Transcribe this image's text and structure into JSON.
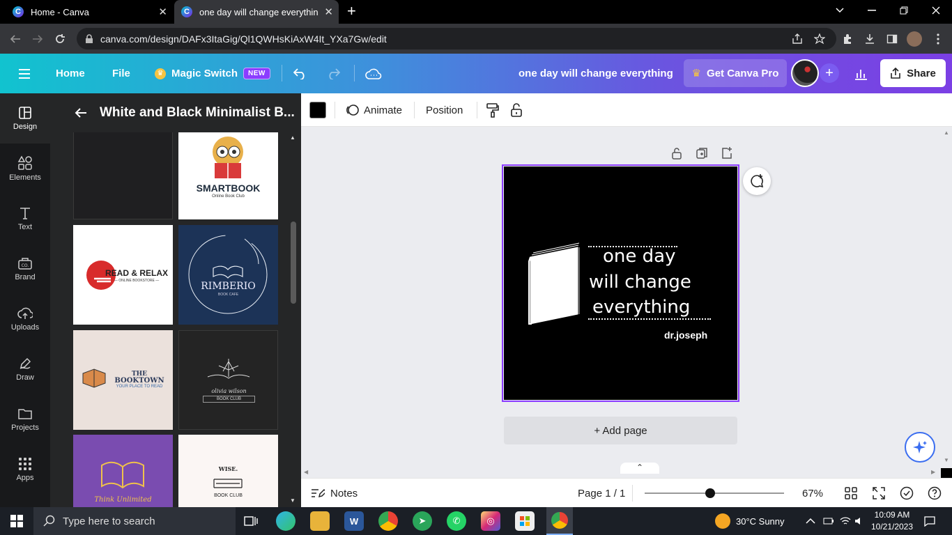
{
  "browser": {
    "tabs": [
      {
        "title": "Home - Canva"
      },
      {
        "title": "one day will change everything - Logo"
      }
    ],
    "url": "canva.com/design/DAFx3ItaGig/Ql1QWHsKiAxW4It_YXa7Gw/edit"
  },
  "header": {
    "home": "Home",
    "file": "File",
    "magic_switch": "Magic Switch",
    "new_badge": "NEW",
    "doc_title": "one day will change everything",
    "get_pro": "Get Canva Pro",
    "share": "Share"
  },
  "rail": [
    {
      "label": "Design",
      "icon": "design-icon"
    },
    {
      "label": "Elements",
      "icon": "elements-icon"
    },
    {
      "label": "Text",
      "icon": "text-icon"
    },
    {
      "label": "Brand",
      "icon": "brand-icon"
    },
    {
      "label": "Uploads",
      "icon": "uploads-icon"
    },
    {
      "label": "Draw",
      "icon": "draw-icon"
    },
    {
      "label": "Projects",
      "icon": "projects-icon"
    },
    {
      "label": "Apps",
      "icon": "apps-icon"
    }
  ],
  "panel": {
    "title": "White and Black Minimalist B...",
    "templates": [
      {
        "name": "",
        "line1": "",
        "line2": ""
      },
      {
        "name": "SMARTBOOK",
        "line1": "SMARTBOOK",
        "line2": "Online Book Club"
      },
      {
        "name": "READ & RELAX",
        "line1": "READ & RELAX",
        "line2": "— ONLINE BOOKSTORE —"
      },
      {
        "name": "RIMBERIO",
        "line1": "RIMBERIO",
        "line2": "BOOK CAFE"
      },
      {
        "name": "THE BOOKTOWN",
        "line1": "THE",
        "line2": "BOOKTOWN",
        "line3": "YOUR PLACE TO READ"
      },
      {
        "name": "olivia wilson",
        "line1": "olivia wilson",
        "line2": "BOOK CLUB"
      },
      {
        "name": "Think Unlimited",
        "line1": "Think Unlimited",
        "line2": ""
      },
      {
        "name": "WISE. BOOK CLUB",
        "line1": "WISE.",
        "line2": "BOOK CLUB"
      }
    ]
  },
  "toolbar": {
    "color": "#000000",
    "animate": "Animate",
    "position": "Position"
  },
  "design": {
    "line1": "one day",
    "line2": "will change",
    "line3": "everything",
    "signature": "dr.joseph",
    "background": "#000000"
  },
  "canvas": {
    "add_page": "+ Add page"
  },
  "footer": {
    "notes": "Notes",
    "page": "Page 1 / 1",
    "zoom": "67%",
    "zoom_level": 0.47
  },
  "taskbar": {
    "search_placeholder": "Type here to search",
    "weather": "30°C  Sunny",
    "time": "10:09 AM",
    "date": "10/21/2023"
  }
}
